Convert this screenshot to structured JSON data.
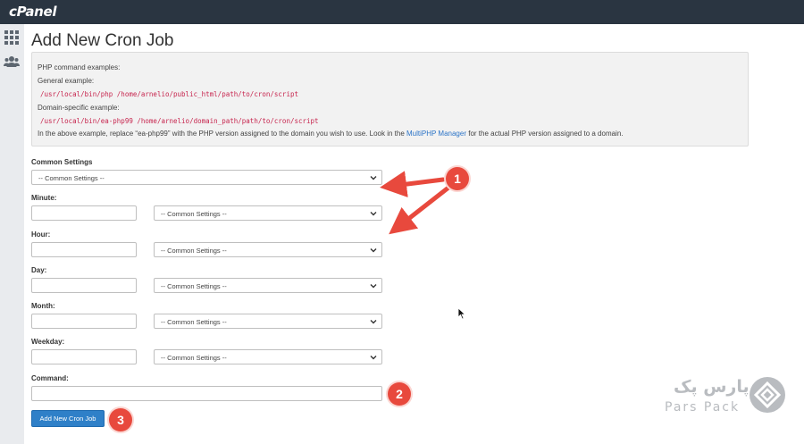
{
  "app": {
    "brand": "cPanel"
  },
  "page": {
    "title": "Add New Cron Job"
  },
  "examples": {
    "heading": "PHP command examples:",
    "general_label": "General example:",
    "general_code": "/usr/local/bin/php /home/arnelio/public_html/path/to/cron/script",
    "domain_label": "Domain-specific example:",
    "domain_code": "/usr/local/bin/ea-php99 /home/arnelio/domain_path/path/to/cron/script",
    "note_before": "In the above example, replace “ea-php99” with the PHP version assigned to the domain you wish to use. Look in the ",
    "note_link": "MultiPHP Manager",
    "note_after": " for the actual PHP version assigned to a domain."
  },
  "form": {
    "common_settings_label": "Common Settings",
    "common_settings_value": "-- Common Settings --",
    "minute_label": "Minute:",
    "hour_label": "Hour:",
    "day_label": "Day:",
    "month_label": "Month:",
    "weekday_label": "Weekday:",
    "field_select_value": "-- Common Settings --",
    "command_label": "Command:",
    "submit_label": "Add New Cron Job"
  },
  "annotations": {
    "badge1": "1",
    "badge2": "2",
    "badge3": "3"
  },
  "watermark": {
    "english": "Pars Pack",
    "persian": "پارس پک"
  },
  "colors": {
    "topbar": "#2a3541",
    "accent_button": "#2f80c8",
    "badge": "#e8493d",
    "code": "#c7254e",
    "link": "#2c74c7"
  }
}
